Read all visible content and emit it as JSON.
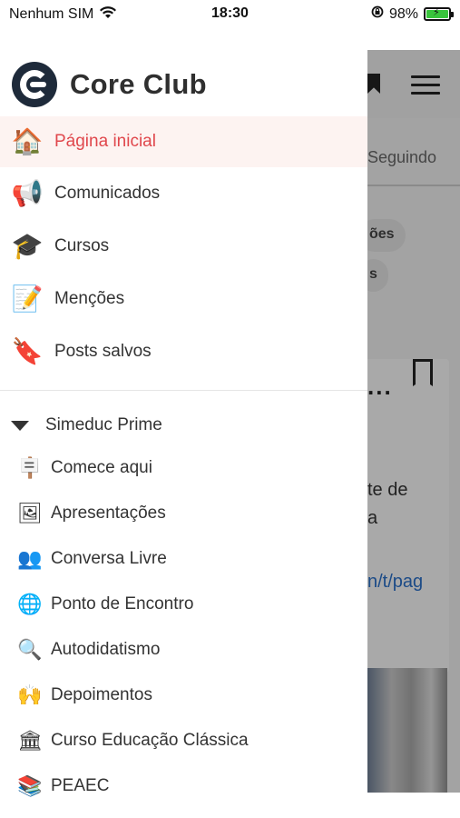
{
  "status_bar": {
    "carrier": "Nenhum SIM",
    "time": "18:30",
    "battery": "98%"
  },
  "drawer": {
    "brand": "Core Club",
    "nav_items": [
      {
        "label": "Página inicial",
        "icon": "🏠"
      },
      {
        "label": "Comunicados",
        "icon": "📢"
      },
      {
        "label": "Cursos",
        "icon": "🎓"
      },
      {
        "label": "Menções",
        "icon": "📝"
      },
      {
        "label": "Posts salvos",
        "icon": "🔖"
      }
    ],
    "section": {
      "title": "Simeduc Prime",
      "items": [
        {
          "label": "Comece aqui",
          "icon": "🪧"
        },
        {
          "label": "Apresentações",
          "icon": "🖼"
        },
        {
          "label": "Conversa Livre",
          "icon": "👥"
        },
        {
          "label": "Ponto de Encontro",
          "icon": "🌐"
        },
        {
          "label": "Autodidatismo",
          "icon": "🔍"
        },
        {
          "label": "Depoimentos",
          "icon": "🙌"
        },
        {
          "label": "Curso Educação Clássica",
          "icon": "🏛"
        },
        {
          "label": "PEAEC",
          "icon": "📚"
        }
      ]
    }
  },
  "background": {
    "tab_text": "Seguindo",
    "chip_1": "ões",
    "chip_2": "s",
    "card_dots": "...",
    "text_line_1": "te de",
    "text_line_2": "a",
    "link_text": "n/t/pag"
  },
  "colors": {
    "accent": "#e0474c",
    "active_bg": "#fdf3f1",
    "logo_bg": "#1e2a3a",
    "link": "#2a6fc8"
  }
}
